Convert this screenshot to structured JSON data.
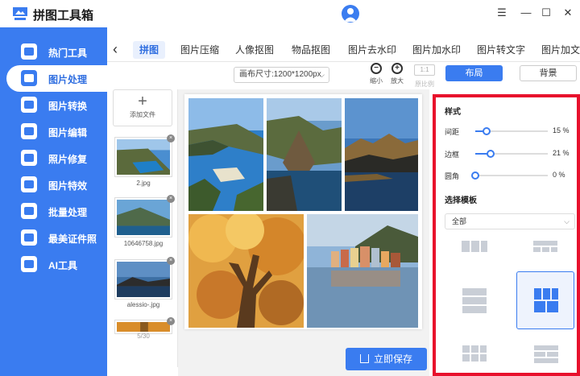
{
  "app": {
    "title": "拼图工具箱"
  },
  "window_controls": {
    "menu": "☰",
    "minimize": "—",
    "maximize": "☐",
    "close": "✕"
  },
  "sidebar": {
    "items": [
      {
        "label": "热门工具",
        "icon": "wrench-icon"
      },
      {
        "label": "图片处理",
        "icon": "image-process-icon",
        "active": true
      },
      {
        "label": "图片转换",
        "icon": "image-convert-icon"
      },
      {
        "label": "图片编辑",
        "icon": "image-edit-icon"
      },
      {
        "label": "照片修复",
        "icon": "photo-repair-icon"
      },
      {
        "label": "图片特效",
        "icon": "image-effects-icon"
      },
      {
        "label": "批量处理",
        "icon": "batch-icon"
      },
      {
        "label": "最美证件照",
        "icon": "id-photo-icon"
      },
      {
        "label": "AI工具",
        "icon": "ai-icon"
      }
    ]
  },
  "tabs": [
    {
      "label": "拼图",
      "active": true
    },
    {
      "label": "图片压缩"
    },
    {
      "label": "人像抠图"
    },
    {
      "label": "物品抠图"
    },
    {
      "label": "图片去水印"
    },
    {
      "label": "图片加水印"
    },
    {
      "label": "图片转文字"
    },
    {
      "label": "图片加文"
    }
  ],
  "toolbar": {
    "canvas_size": "画布尺寸:1200*1200px",
    "zoom_out_label": "缩小",
    "zoom_in_label": "放大",
    "ratio_button": "1:1",
    "ratio_label": "原比例",
    "layout_button": "布局",
    "background_button": "背景"
  },
  "file_panel": {
    "add_label": "添加文件",
    "files": [
      {
        "name": "2.jpg"
      },
      {
        "name": "10646758.jpg"
      },
      {
        "name": "alessio-.jpg"
      },
      {
        "name": ""
      }
    ],
    "page_current": "5",
    "page_total": "30"
  },
  "save_button": "立即保存",
  "style_panel": {
    "title": "样式",
    "sliders": [
      {
        "label": "间距",
        "value": 15,
        "unit": "%"
      },
      {
        "label": "边框",
        "value": 21,
        "unit": "%"
      },
      {
        "label": "圆角",
        "value": 0,
        "unit": "%"
      }
    ],
    "template_title": "选择模板",
    "template_filter": "全部",
    "selected_template": 3
  },
  "colors": {
    "accent": "#3a7cf0",
    "highlight_border": "#e8102c"
  }
}
